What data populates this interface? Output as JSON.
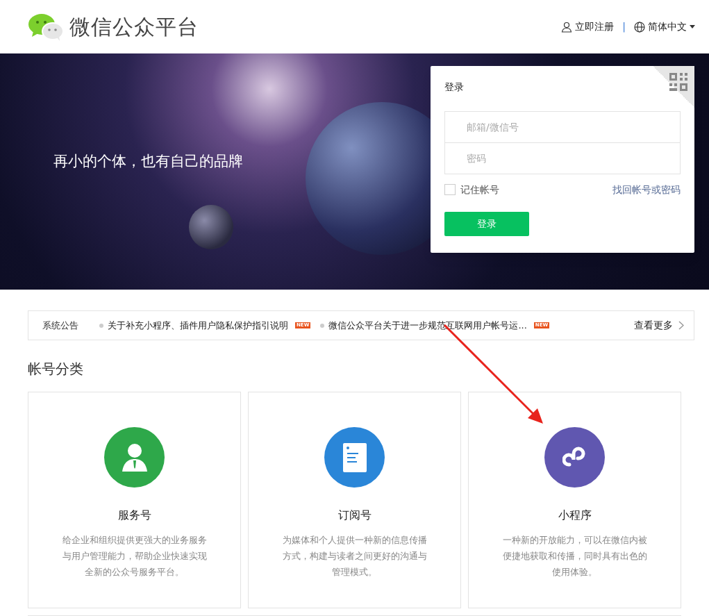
{
  "header": {
    "brand": "微信公众平台",
    "register": "立即注册",
    "separator": "|",
    "language": "简体中文"
  },
  "banner": {
    "slogan": "再小的个体，也有自己的品牌"
  },
  "login": {
    "title": "登录",
    "account_placeholder": "邮箱/微信号",
    "password_placeholder": "密码",
    "remember": {
      "label": "记住帐号",
      "checked": false
    },
    "forgot": "找回帐号或密码",
    "submit": "登录"
  },
  "notices": {
    "label": "系统公告",
    "items": [
      {
        "text": "关于补充小程序、插件用户隐私保护指引说明",
        "badge": "NEW"
      },
      {
        "text": "微信公众平台关于进一步规范互联网用户帐号运...",
        "badge": "NEW"
      }
    ],
    "more": "查看更多"
  },
  "section": {
    "title": "帐号分类"
  },
  "account_types": [
    {
      "kind": "service",
      "color": "#2ea84a",
      "name": "服务号",
      "description": "给企业和组织提供更强大的业务服务与用户管理能力，帮助企业快速实现全新的公众号服务平台。"
    },
    {
      "kind": "subscription",
      "color": "#2a86d8",
      "name": "订阅号",
      "description": "为媒体和个人提供一种新的信息传播方式，构建与读者之间更好的沟通与管理模式。"
    },
    {
      "kind": "miniprogram",
      "color": "#6057b0",
      "name": "小程序",
      "description": "一种新的开放能力，可以在微信内被便捷地获取和传播，同时具有出色的使用体验。"
    }
  ]
}
